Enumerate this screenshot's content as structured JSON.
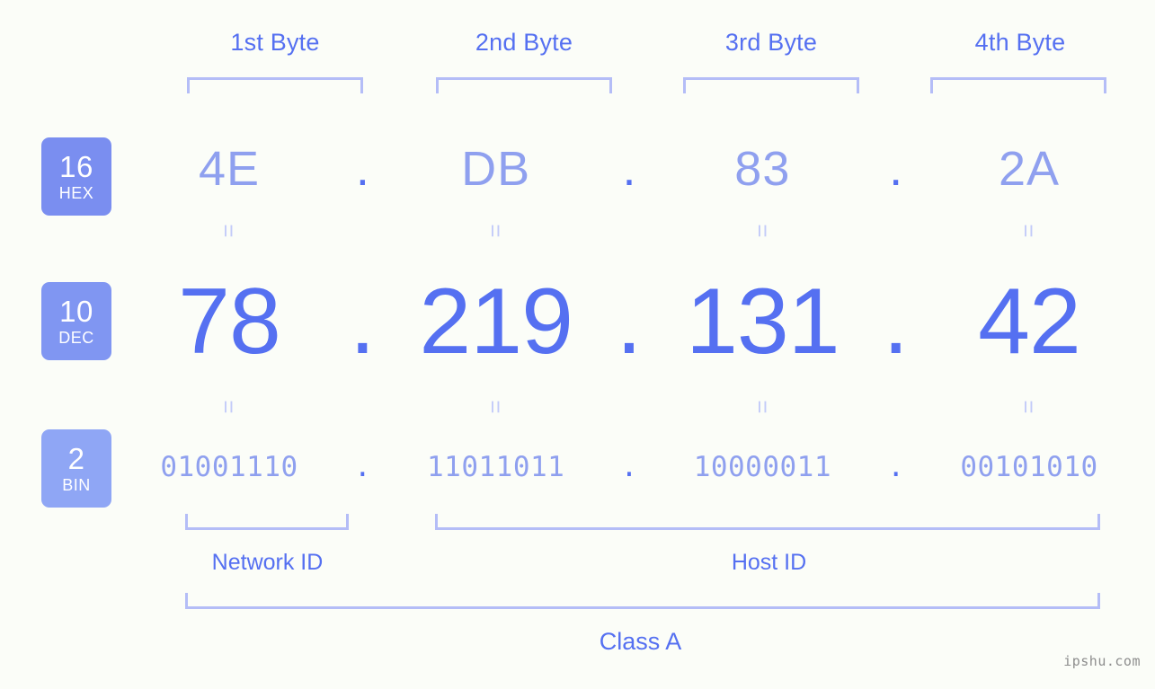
{
  "background_color": "#fbfdf8",
  "accent_color": "#5570f1",
  "accent_light_color": "#8fa0ef",
  "bracket_color": "#b4bdf7",
  "byte_headers": [
    {
      "label": "1st Byte"
    },
    {
      "label": "2nd Byte"
    },
    {
      "label": "3rd Byte"
    },
    {
      "label": "4th Byte"
    }
  ],
  "bases": [
    {
      "number": "16",
      "name": "HEX",
      "color": "#7a8ef0"
    },
    {
      "number": "10",
      "name": "DEC",
      "color": "#8096f2"
    },
    {
      "number": "2",
      "name": "BIN",
      "color": "#8fa6f5"
    }
  ],
  "separator": ".",
  "rows": {
    "hex": {
      "values": [
        "4E",
        "DB",
        "83",
        "2A"
      ]
    },
    "dec": {
      "values": [
        "78",
        "219",
        "131",
        "42"
      ]
    },
    "bin": {
      "values": [
        "01001110",
        "11011011",
        "10000011",
        "00101010"
      ]
    }
  },
  "equals_mark": "=",
  "segments": {
    "network_id": "Network ID",
    "host_id": "Host ID"
  },
  "class_label": "Class A",
  "watermark": "ipshu.com"
}
